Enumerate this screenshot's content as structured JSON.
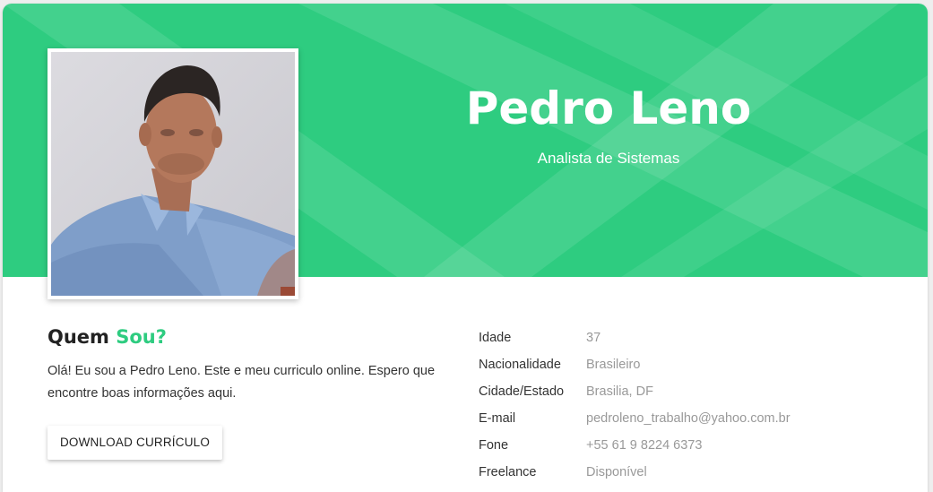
{
  "colors": {
    "accent": "#2ecc80",
    "banner": "#2ecc80"
  },
  "header": {
    "name": "Pedro Leno",
    "role": "Analista de Sistemas"
  },
  "profile_photo": {
    "alt": "Profile photo"
  },
  "about": {
    "title_plain": "Quem ",
    "title_accent": "Sou?",
    "text": "Olá! Eu sou a Pedro Leno. Este e meu curriculo online. Espero que encontre boas informações aqui.",
    "download_label": "DOWNLOAD CURRÍCULO"
  },
  "info": [
    {
      "label": "Idade",
      "value": "37"
    },
    {
      "label": "Nacionalidade",
      "value": "Brasileiro"
    },
    {
      "label": "Cidade/Estado",
      "value": "Brasilia, DF"
    },
    {
      "label": "E-mail",
      "value": "pedroleno_trabalho@yahoo.com.br"
    },
    {
      "label": "Fone",
      "value": "+55 61 9 8224 6373"
    },
    {
      "label": "Freelance",
      "value": "Disponível"
    }
  ]
}
